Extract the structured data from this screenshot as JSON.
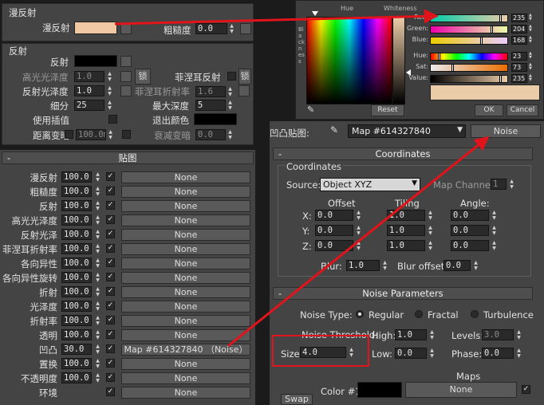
{
  "top": {
    "group_title": "漫反射",
    "diffuse_label": "漫反射",
    "diffuse_color": "#f0c9a4",
    "roughness_label": "粗糙度",
    "roughness_value": "0.0"
  },
  "reflect": {
    "group_title": "反射",
    "reflect_label": "反射",
    "gloss_hl_label": "高光光泽度",
    "gloss_hl_value": "1.0",
    "lock_label": "锁",
    "fresnel_label": "菲涅耳反射",
    "lock2_label": "锁",
    "refl_gloss_label": "反射光泽度",
    "refl_gloss_value": "1.0",
    "fresnel_ior_label": "菲涅耳折射率",
    "fresnel_ior_value": "1.6",
    "subdivs_label": "细分",
    "subdivs_value": "25",
    "max_depth_label": "最大深度",
    "max_depth_value": "5",
    "interp_label": "使用插值",
    "exit_color_label": "退出颜色",
    "dim_dist_label": "距离变暗",
    "dim_dist_value": "100.0m",
    "dim_falloff_label": "衰减变暗",
    "dim_falloff_value": "0.0"
  },
  "maps": {
    "title": "贴图",
    "rows": [
      {
        "label": "漫反射",
        "amount": "100.0",
        "map": "None"
      },
      {
        "label": "粗糙度",
        "amount": "100.0",
        "map": "None"
      },
      {
        "label": "反射",
        "amount": "100.0",
        "map": "None"
      },
      {
        "label": "高光光泽度",
        "amount": "100.0",
        "map": "None"
      },
      {
        "label": "反射光泽",
        "amount": "100.0",
        "map": "None"
      },
      {
        "label": "菲涅耳折射率",
        "amount": "100.0",
        "map": "None"
      },
      {
        "label": "各向异性",
        "amount": "100.0",
        "map": "None"
      },
      {
        "label": "各向异性旋转",
        "amount": "100.0",
        "map": "None"
      },
      {
        "label": "折射",
        "amount": "100.0",
        "map": "None"
      },
      {
        "label": "光泽度",
        "amount": "100.0",
        "map": "None"
      },
      {
        "label": "折射率",
        "amount": "100.0",
        "map": "None"
      },
      {
        "label": "透明",
        "amount": "100.0",
        "map": "None"
      },
      {
        "label": "凹凸",
        "amount": "30.0",
        "map": "Map #614327840 （Noise）"
      },
      {
        "label": "置换",
        "amount": "100.0",
        "map": "None"
      },
      {
        "label": "不透明度",
        "amount": "100.0",
        "map": "None"
      },
      {
        "label": "环境",
        "amount": "",
        "map": "None"
      }
    ]
  },
  "color_picker": {
    "hue_label": "Hue",
    "whiteness_label": "Whiteness",
    "blackness_label": "Blackness",
    "channels": [
      {
        "label": "Red:",
        "value": "235"
      },
      {
        "label": "Green:",
        "value": "204"
      },
      {
        "label": "Blue:",
        "value": "168"
      },
      {
        "label": "Hue:",
        "value": "23"
      },
      {
        "label": "Sat:",
        "value": "73"
      },
      {
        "label": "Value:",
        "value": "235"
      }
    ],
    "reset_label": "Reset",
    "ok_label": "OK",
    "cancel_label": "Cancel",
    "current_color": "#ebcca8"
  },
  "bump_bar": {
    "label": "凹凸贴图:",
    "map_name": "Map #614327840",
    "type_button": "Noise"
  },
  "coordinates": {
    "rollout_title": "Coordinates",
    "group_title": "Coordinates",
    "source_label": "Source:",
    "source_value": "Object XYZ",
    "map_channel_label": "Map Channel:",
    "map_channel_value": "1",
    "offset_label": "Offset",
    "tiling_label": "Tiling",
    "angle_label": "Angle:",
    "rows": [
      {
        "axis": "X:",
        "offset": "0.0",
        "tiling": "1.0",
        "angle": "0.0"
      },
      {
        "axis": "Y:",
        "offset": "0.0",
        "tiling": "1.0",
        "angle": "0.0"
      },
      {
        "axis": "Z:",
        "offset": "0.0",
        "tiling": "1.0",
        "angle": "0.0"
      }
    ],
    "blur_label": "Blur:",
    "blur_value": "1.0",
    "blur_offset_label": "Blur offset:",
    "blur_offset_value": "0.0"
  },
  "noise": {
    "rollout_title": "Noise Parameters",
    "type_label": "Noise Type:",
    "types": [
      "Regular",
      "Fractal",
      "Turbulence"
    ],
    "selected_type": "Regular",
    "threshold_label": "Noise Threshold:",
    "high_label": "High:",
    "high_value": "1.0",
    "levels_label": "Levels:",
    "levels_value": "3.0",
    "size_label": "Size:",
    "size_value": "4.0",
    "low_label": "Low:",
    "low_value": "0.0",
    "phase_label": "Phase:",
    "phase_value": "0.0",
    "maps_label": "Maps",
    "color1_label": "Color #1",
    "color1_map": "None",
    "swap_label": "Swap"
  },
  "colors": {
    "annotation": "#e0141a",
    "panel_bg": "#444444"
  }
}
